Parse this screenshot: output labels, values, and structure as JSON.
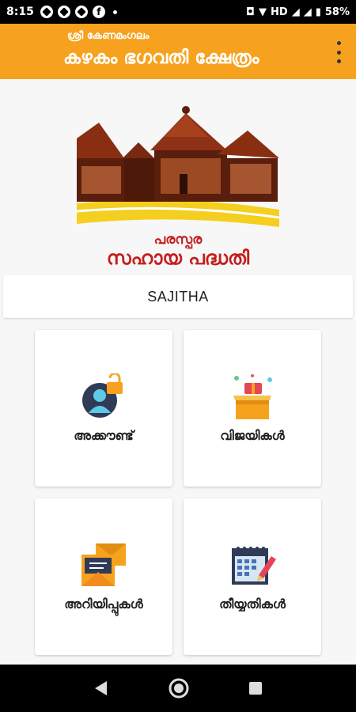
{
  "status_bar": {
    "time": "8:15",
    "network": "HD",
    "battery": "58%"
  },
  "app_bar": {
    "subtitle": "ശ്രീ കേണമംഗലം",
    "title": "കഴകം ഭഗവതി ക്ഷേത്രം"
  },
  "logo": {
    "caption_line1": "പരസ്പര",
    "caption_line2": "സഹായ പദ്ധതി"
  },
  "user": {
    "name": "SAJITHA"
  },
  "menu": {
    "account": "അക്കൗണ്ട്",
    "winners": "വിജയികൾ",
    "notices": "അറിയിപ്പുകൾ",
    "dates": "തീയ്യതികൾ"
  }
}
